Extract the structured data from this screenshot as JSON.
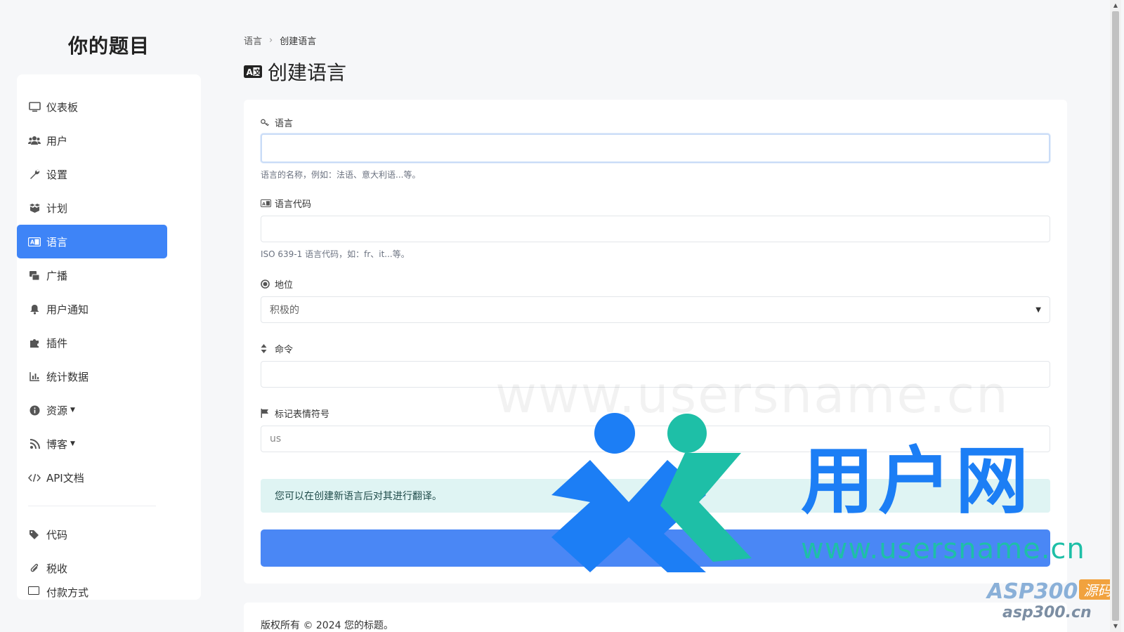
{
  "site_title": "你的题目",
  "sidebar": {
    "items": [
      {
        "label": "仪表板",
        "icon": "monitor-icon",
        "active": false
      },
      {
        "label": "用户",
        "icon": "users-icon",
        "active": false
      },
      {
        "label": "设置",
        "icon": "wrench-icon",
        "active": false
      },
      {
        "label": "计划",
        "icon": "box-icon",
        "active": false
      },
      {
        "label": "语言",
        "icon": "language-icon",
        "active": true
      },
      {
        "label": "广播",
        "icon": "broadcast-icon",
        "active": false
      },
      {
        "label": "用户通知",
        "icon": "bell-icon",
        "active": false
      },
      {
        "label": "插件",
        "icon": "puzzle-icon",
        "active": false
      },
      {
        "label": "统计数据",
        "icon": "chart-icon",
        "active": false
      },
      {
        "label": "资源",
        "icon": "info-icon",
        "active": false,
        "has_dropdown": true
      },
      {
        "label": "博客",
        "icon": "rss-icon",
        "active": false,
        "has_dropdown": true
      },
      {
        "label": "API文档",
        "icon": "code-icon",
        "active": false
      }
    ],
    "items_secondary": [
      {
        "label": "代码",
        "icon": "tags-icon"
      },
      {
        "label": "税收",
        "icon": "paperclip-icon"
      },
      {
        "label": "付款方式",
        "icon": "card-icon"
      }
    ]
  },
  "breadcrumb": {
    "parent": "语言",
    "current": "创建语言"
  },
  "page_title": "创建语言",
  "form": {
    "language": {
      "label": "语言",
      "value": "",
      "help": "语言的名称，例如：法语、意大利语...等。"
    },
    "code": {
      "label": "语言代码",
      "value": "",
      "help": "ISO 639-1 语言代码，如：fr、it...等。"
    },
    "status": {
      "label": "地位",
      "selected": "积极的"
    },
    "order": {
      "label": "命令",
      "value": ""
    },
    "flag": {
      "label": "标记表情符号",
      "placeholder": "us"
    },
    "notice": "您可以在创建新语言后对其进行翻译。",
    "submit_label": ""
  },
  "footer": {
    "text": "版权所有 © 2024 您的标题。"
  },
  "watermark": {
    "brand": "用户网",
    "url": "www.usersname.cn",
    "stamp_main": "ASP300",
    "stamp_tag": "源码",
    "stamp_url": "asp300.cn"
  },
  "colors": {
    "accent": "#3e84f7",
    "alert_bg": "#dff4f3",
    "brand_blue": "#1c7ef5",
    "brand_teal": "#1ebfa7"
  }
}
